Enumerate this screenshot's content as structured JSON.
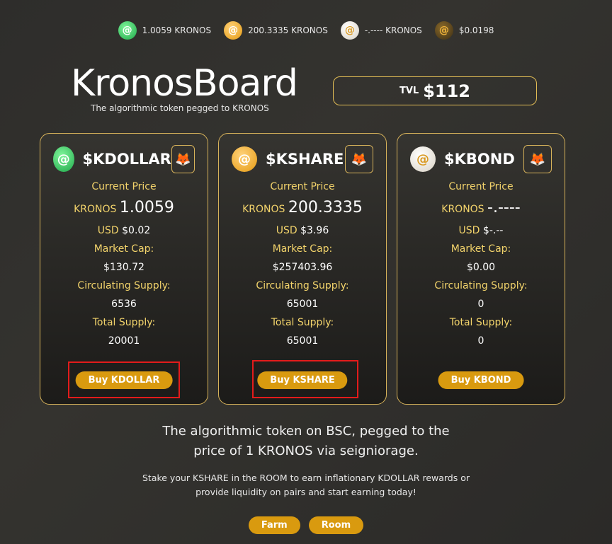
{
  "ticker": [
    {
      "icon": "kdollar-coin-icon",
      "text": "1.0059 KRONOS"
    },
    {
      "icon": "kshare-coin-icon",
      "text": "200.3335 KRONOS"
    },
    {
      "icon": "kbond-coin-icon",
      "text": "-.---- KRONOS"
    },
    {
      "icon": "kronos-coin-icon",
      "text": "$0.0198"
    }
  ],
  "header": {
    "title": "KronosBoard",
    "subtitle": "The algorithmic token pegged to KRONOS",
    "tvl_label": "TVL",
    "tvl_value": "$112"
  },
  "cards": [
    {
      "name": "$KDOLLAR",
      "current_price_label": "Current Price",
      "price_unit": "KRONOS",
      "price": "1.0059",
      "usd_label": "USD",
      "usd": "$0.02",
      "mcap_label": "Market Cap:",
      "mcap": "$130.72",
      "circ_label": "Circulating Supply:",
      "circ": "6536",
      "total_label": "Total Supply:",
      "total": "20001",
      "buy_label": "Buy KDOLLAR"
    },
    {
      "name": "$KSHARE",
      "current_price_label": "Current Price",
      "price_unit": "KRONOS",
      "price": "200.3335",
      "usd_label": "USD",
      "usd": "$3.96",
      "mcap_label": "Market Cap:",
      "mcap": "$257403.96",
      "circ_label": "Circulating Supply:",
      "circ": "65001",
      "total_label": "Total Supply:",
      "total": "65001",
      "buy_label": "Buy KSHARE"
    },
    {
      "name": "$KBOND",
      "current_price_label": "Current Price",
      "price_unit": "KRONOS",
      "price": "-.----",
      "usd_label": "USD",
      "usd": "$-.--",
      "mcap_label": "Market Cap:",
      "mcap": "$0.00",
      "circ_label": "Circulating Supply:",
      "circ": "0",
      "total_label": "Total Supply:",
      "total": "0",
      "buy_label": "Buy KBOND"
    }
  ],
  "footer": {
    "tagline_1": "The algorithmic token on BSC, pegged to the",
    "tagline_2": "price of 1 KRONOS via seigniorage.",
    "desc_1": "Stake your KSHARE in the ROOM to earn inflationary KDOLLAR rewards or",
    "desc_2": "provide liquidity on pairs and start earning today!",
    "farm_label": "Farm",
    "room_label": "Room"
  },
  "colors": {
    "accent": "#d99a0f",
    "border": "#d6b25a",
    "label": "#f2d36b",
    "highlight": "#e31b1b"
  }
}
